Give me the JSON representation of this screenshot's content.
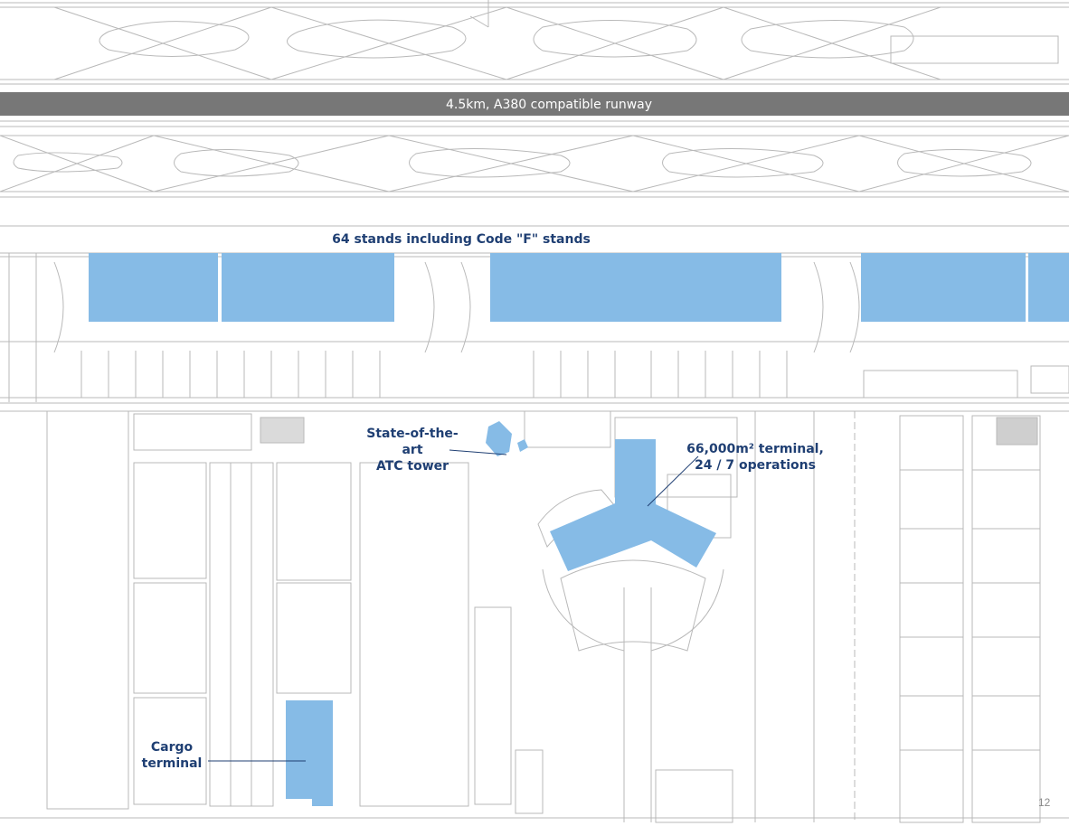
{
  "map": {
    "runway_label": "4.5km, A380 compatible runway",
    "stands_label": "64 stands including Code \"F\" stands",
    "atc_label_line1": "State-of-the-art",
    "atc_label_line2": "ATC tower",
    "terminal_label_line1": "66,000m² terminal,",
    "terminal_label_line2": "24 / 7 operations",
    "cargo_label_line1": "Cargo",
    "cargo_label_line2": "terminal"
  },
  "page_number": "12",
  "colors": {
    "line": "#b9b9b9",
    "highlight": "#86bbe6",
    "runway": "#777777",
    "label": "#1f3f73"
  }
}
